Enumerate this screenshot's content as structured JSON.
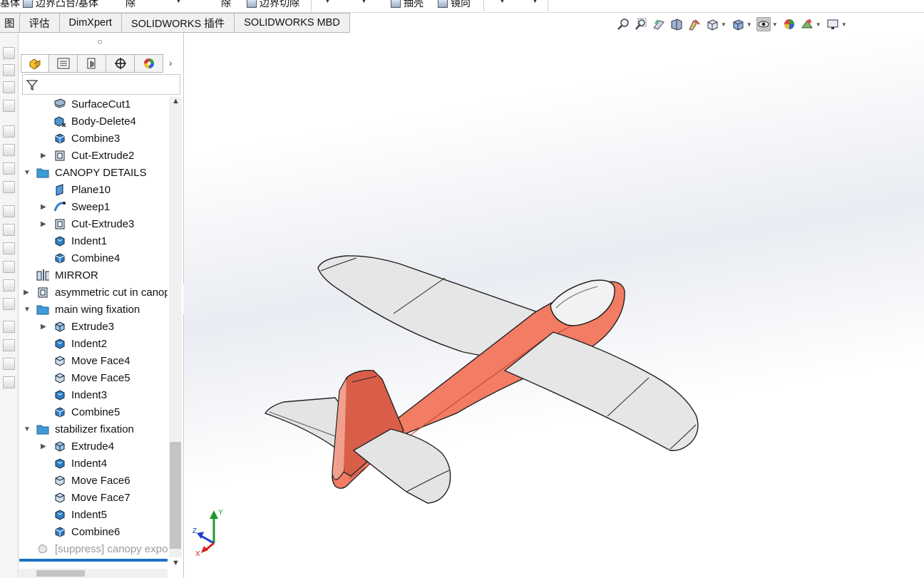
{
  "ribbon": {
    "item1": "边界凸台/基体",
    "item2": "除",
    "item3": "除",
    "item4": "边界切除",
    "item5": "抽壳",
    "item6": "镜向",
    "left_fragment": "基体"
  },
  "tabs": [
    {
      "label": "图"
    },
    {
      "label": "评估"
    },
    {
      "label": "DimXpert"
    },
    {
      "label": "SOLIDWORKS 插件"
    },
    {
      "label": "SOLIDWORKS MBD"
    }
  ],
  "tree": [
    {
      "label": "SurfaceCut1",
      "expandable": false,
      "level": 2,
      "icon": "surface-cut-icon"
    },
    {
      "label": "Body-Delete4",
      "expandable": false,
      "level": 2,
      "icon": "body-delete-icon"
    },
    {
      "label": "Combine3",
      "expandable": false,
      "level": 2,
      "icon": "combine-icon"
    },
    {
      "label": "Cut-Extrude2",
      "expandable": true,
      "level": 2,
      "icon": "cut-extrude-icon"
    },
    {
      "label": "CANOPY DETAILS",
      "expandable": true,
      "expanded": true,
      "level": 1,
      "icon": "folder-icon"
    },
    {
      "label": "Plane10",
      "expandable": false,
      "level": 2,
      "icon": "plane-icon"
    },
    {
      "label": "Sweep1",
      "expandable": true,
      "level": 2,
      "icon": "sweep-icon"
    },
    {
      "label": "Cut-Extrude3",
      "expandable": true,
      "level": 2,
      "icon": "cut-extrude-icon"
    },
    {
      "label": "Indent1",
      "expandable": false,
      "level": 2,
      "icon": "indent-icon"
    },
    {
      "label": "Combine4",
      "expandable": false,
      "level": 2,
      "icon": "combine-icon"
    },
    {
      "label": "MIRROR",
      "expandable": false,
      "level": 1,
      "icon": "mirror-icon"
    },
    {
      "label": "asymmetric cut in canopy",
      "expandable": true,
      "level": 1,
      "icon": "cut-extrude-icon"
    },
    {
      "label": "main wing fixation",
      "expandable": true,
      "expanded": true,
      "level": 1,
      "icon": "folder-icon"
    },
    {
      "label": "Extrude3",
      "expandable": true,
      "level": 2,
      "icon": "extrude-icon"
    },
    {
      "label": "Indent2",
      "expandable": false,
      "level": 2,
      "icon": "indent-icon"
    },
    {
      "label": "Move Face4",
      "expandable": false,
      "level": 2,
      "icon": "move-face-icon"
    },
    {
      "label": "Move Face5",
      "expandable": false,
      "level": 2,
      "icon": "move-face-icon"
    },
    {
      "label": "Indent3",
      "expandable": false,
      "level": 2,
      "icon": "indent-icon"
    },
    {
      "label": "Combine5",
      "expandable": false,
      "level": 2,
      "icon": "combine-icon"
    },
    {
      "label": "stabilizer fixation",
      "expandable": true,
      "expanded": true,
      "level": 1,
      "icon": "folder-icon"
    },
    {
      "label": "Extrude4",
      "expandable": true,
      "level": 2,
      "icon": "extrude-icon"
    },
    {
      "label": "Indent4",
      "expandable": false,
      "level": 2,
      "icon": "indent-icon"
    },
    {
      "label": "Move Face6",
      "expandable": false,
      "level": 2,
      "icon": "move-face-icon"
    },
    {
      "label": "Move Face7",
      "expandable": false,
      "level": 2,
      "icon": "move-face-icon"
    },
    {
      "label": "Indent5",
      "expandable": false,
      "level": 2,
      "icon": "indent-icon"
    },
    {
      "label": "Combine6",
      "expandable": false,
      "level": 2,
      "icon": "combine-icon"
    },
    {
      "label": "[suppress] canopy export",
      "expandable": false,
      "level": 1,
      "icon": "suppressed-feature-icon",
      "suppressed": true
    }
  ],
  "triad": {
    "x": "X",
    "y": "Y",
    "z": "Z"
  },
  "colors": {
    "fuselage": "#f27c64",
    "fin": "#d95e4a",
    "wing": "#e6e6e6",
    "tab_bg": "#f0f0f0",
    "selection_blue": "#1f6fc5",
    "axis_x": "#d62020",
    "axis_y": "#1f9a2c",
    "axis_z": "#1f3fc8"
  }
}
